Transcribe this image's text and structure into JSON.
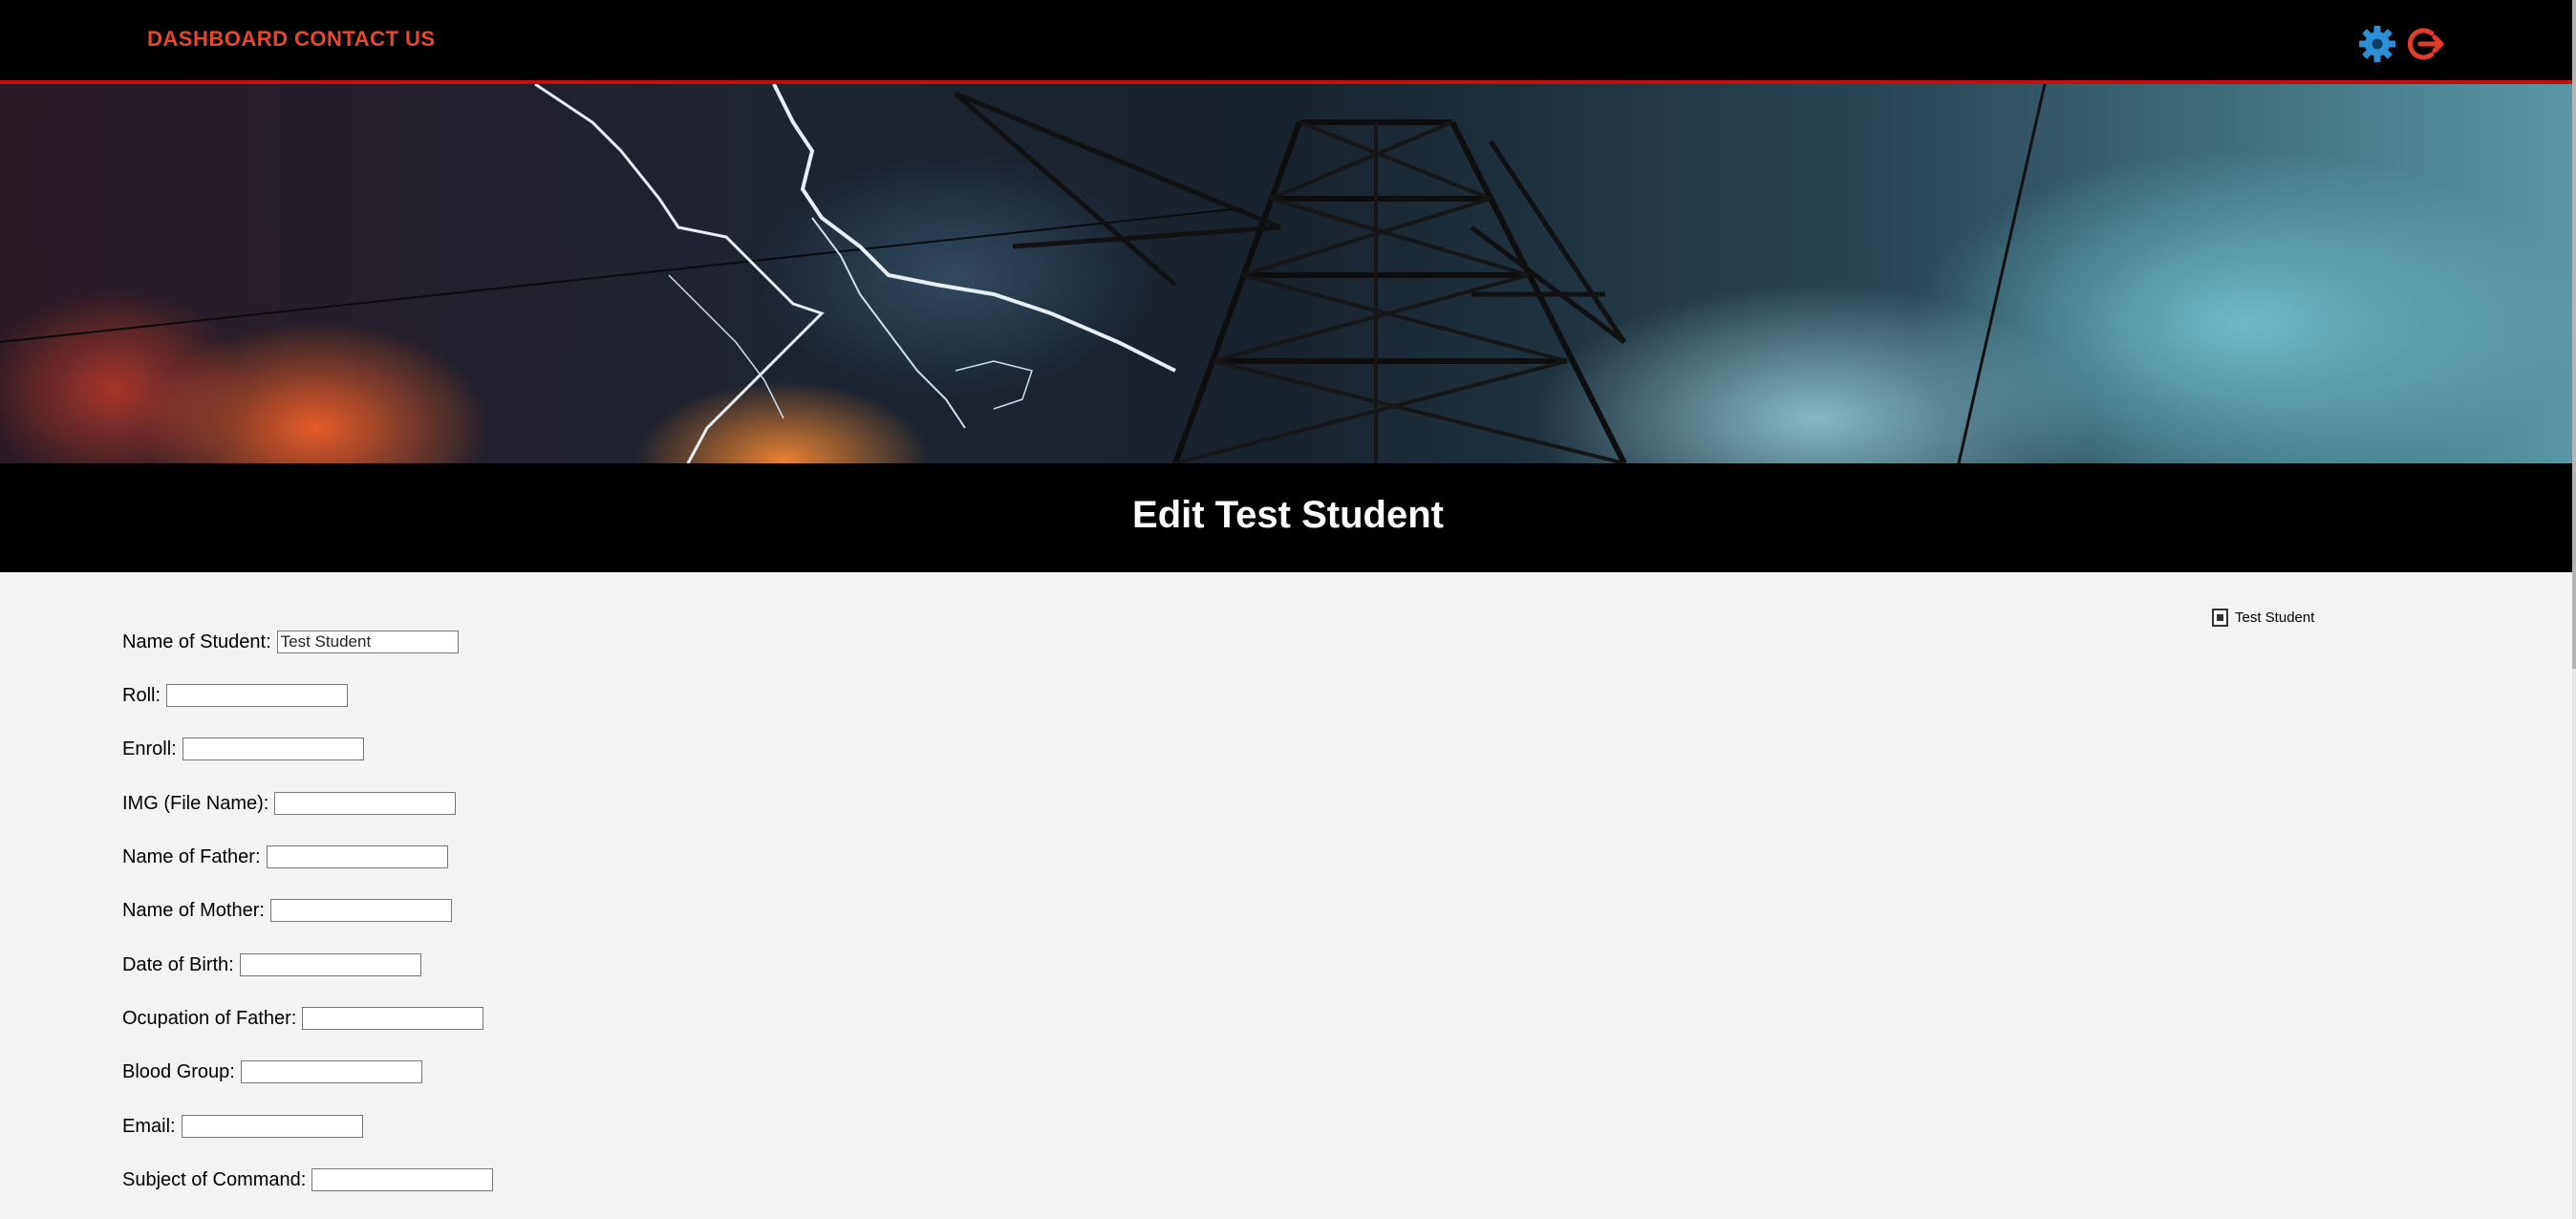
{
  "nav": {
    "links": [
      "DASHBOARD",
      "CONTACT US"
    ],
    "icons": [
      "gear-icon",
      "logout-icon"
    ],
    "link_color": "#e8472b",
    "accent_color": "#c40f0f"
  },
  "page": {
    "title": "Edit Test Student"
  },
  "form": {
    "fields": [
      {
        "label": "Name of Student:",
        "value": "Test Student"
      },
      {
        "label": "Roll:",
        "value": ""
      },
      {
        "label": "Enroll:",
        "value": ""
      },
      {
        "label": "IMG (File Name):",
        "value": ""
      },
      {
        "label": "Name of Father:",
        "value": ""
      },
      {
        "label": "Name of Mother:",
        "value": ""
      },
      {
        "label": "Date of Birth:",
        "value": ""
      },
      {
        "label": "Ocupation of Father:",
        "value": ""
      },
      {
        "label": "Blood Group:",
        "value": ""
      },
      {
        "label": "Email:",
        "value": ""
      },
      {
        "label": "Subject of Command:",
        "value": ""
      }
    ]
  },
  "student_image": {
    "alt": "Test Student"
  }
}
